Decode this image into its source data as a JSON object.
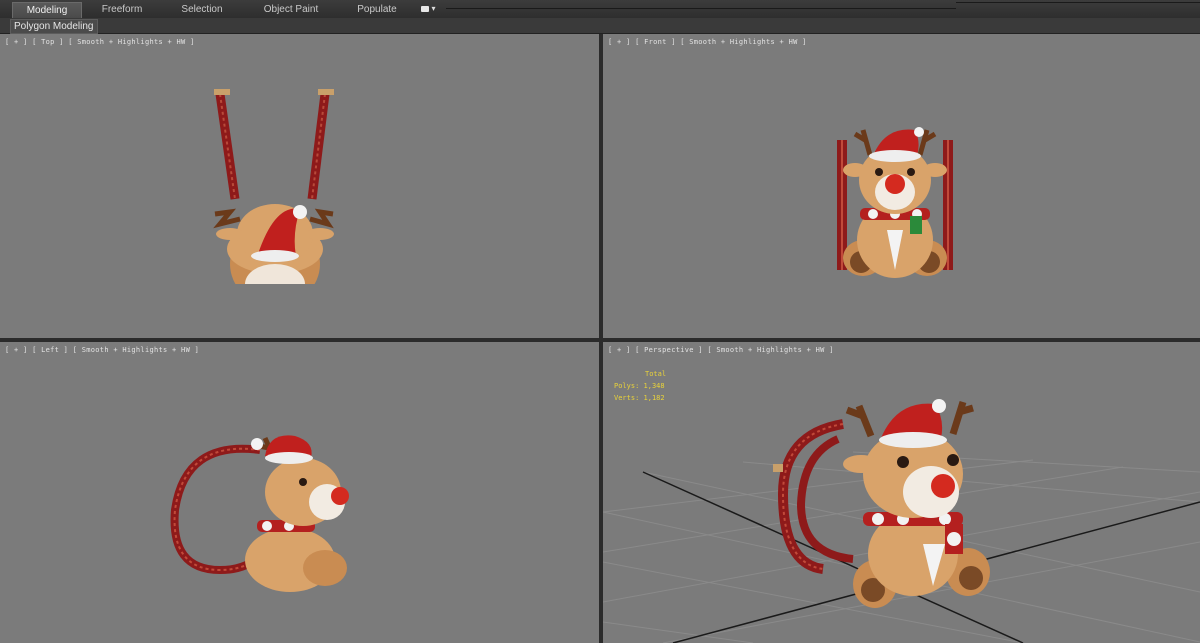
{
  "ribbon": {
    "tabs": [
      "Modeling",
      "Freeform",
      "Selection",
      "Object Paint",
      "Populate"
    ],
    "active_tab": "Modeling",
    "sub_label": "Polygon Modeling"
  },
  "viewports": {
    "top": "[ + ] [ Top ] [ Smooth + Highlights + HW ]",
    "front": "[ + ] [ Front ] [ Smooth + Highlights + HW ]",
    "left": "[ + ] [ Left ] [ Smooth + Highlights + HW ]",
    "perspective": "[ + ] [ Perspective ] [ Smooth + Highlights + HW ]"
  },
  "stats": {
    "header": "Total",
    "polys_label": "Polys:",
    "polys_value": "1,348",
    "verts_label": "Verts:",
    "verts_value": "1,182"
  },
  "colors": {
    "viewport_bg": "#7b7b7b",
    "stats_text": "#e8d23a",
    "fur": "#d9a36a",
    "hat_red": "#c0201e",
    "strap_red": "#8e1a1a",
    "antler": "#6b3a1a"
  }
}
